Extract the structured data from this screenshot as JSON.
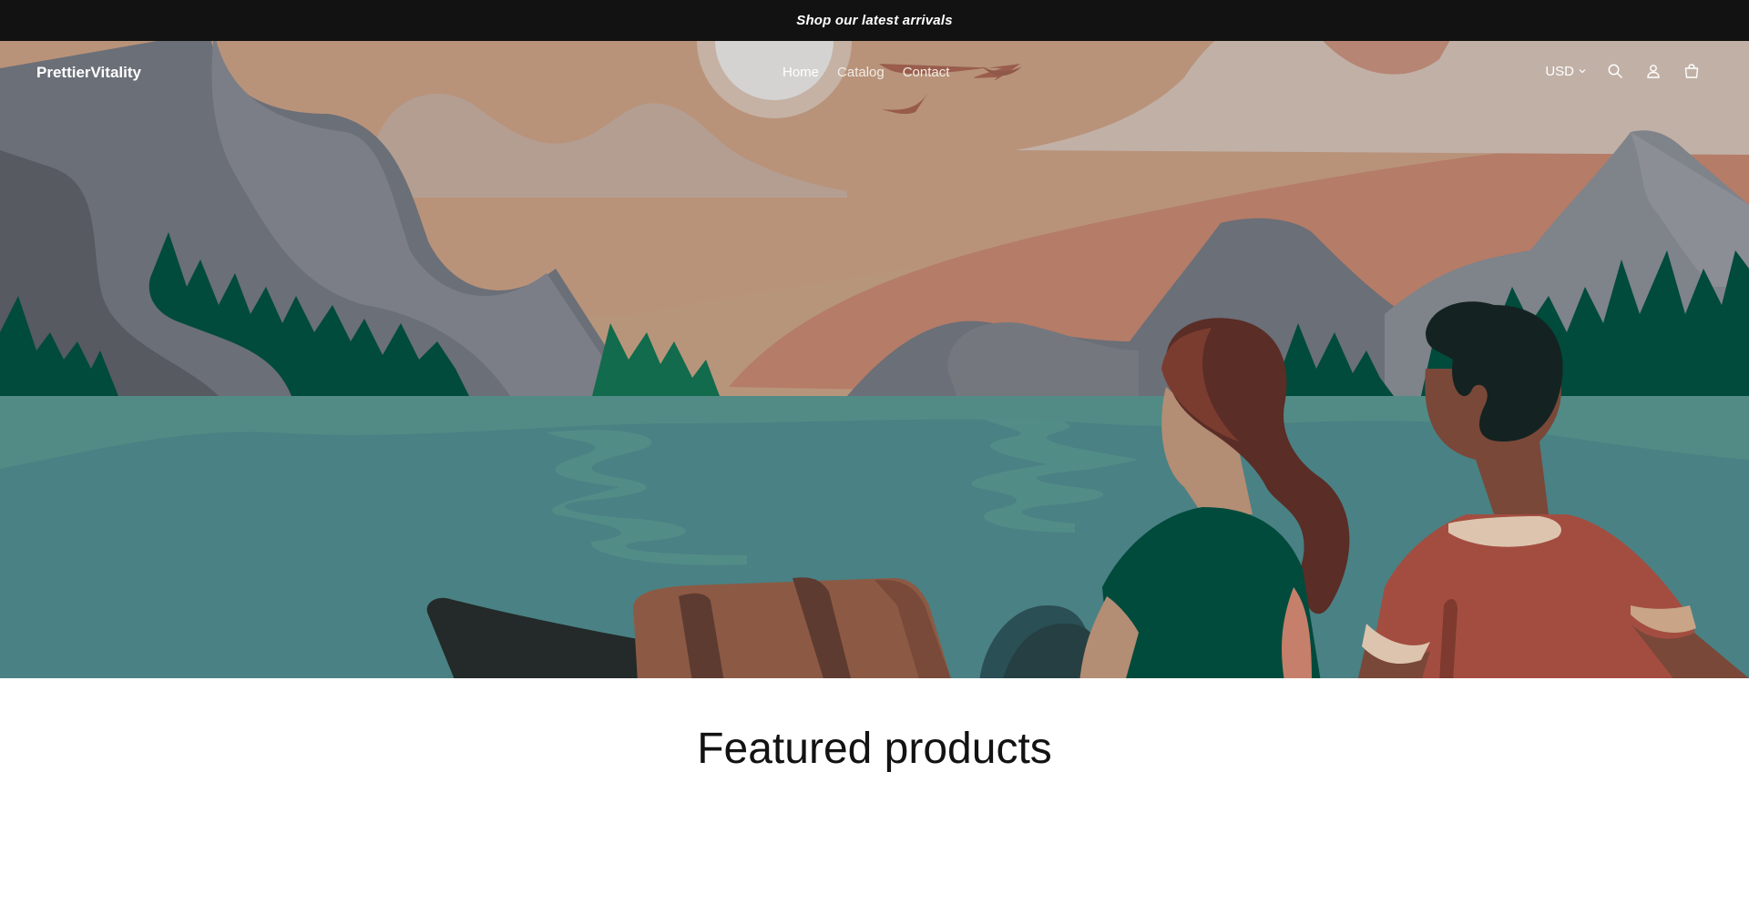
{
  "announcement": {
    "text": "Shop our latest arrivals"
  },
  "header": {
    "logo": "PrettierVitality",
    "nav": [
      {
        "label": "Home",
        "active": true
      },
      {
        "label": "Catalog",
        "active": false
      },
      {
        "label": "Contact",
        "active": false
      }
    ],
    "currency": "USD",
    "icons": {
      "search": "search-icon",
      "account": "account-icon",
      "cart": "cart-icon",
      "currency_caret": "chevron-down-icon"
    }
  },
  "hero": {
    "illustration": "lake-landscape-with-couple-in-boat"
  },
  "featured": {
    "heading": "Featured products"
  },
  "colors": {
    "announcement_bg": "#121212",
    "sky": "#b7957b",
    "water": "#4a8184",
    "trees": "#004b3c",
    "mountains": "#6b6f77"
  }
}
